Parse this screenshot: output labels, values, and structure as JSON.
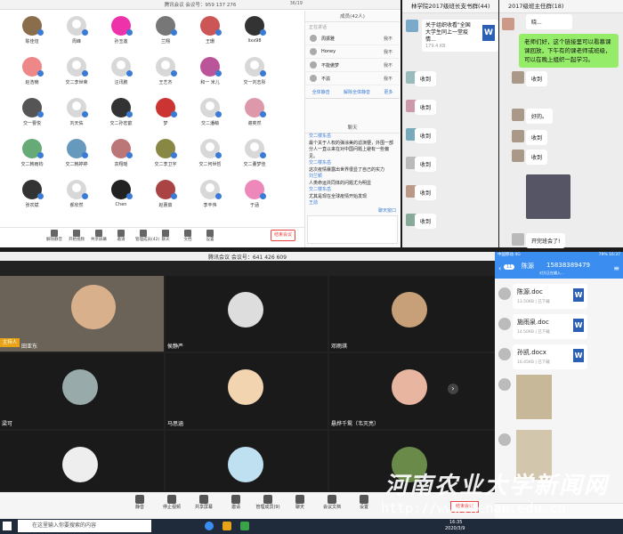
{
  "top_left_meeting": {
    "title": "腾讯会议 会议号：959 137 276",
    "member_count_text": "36/19",
    "participants": [
      {
        "name": "陈佳煊"
      },
      {
        "name": "周峰"
      },
      {
        "name": "孙玉莲"
      },
      {
        "name": "兰翔"
      },
      {
        "name": "王珊"
      },
      {
        "name": "lixx98"
      },
      {
        "name": "赵浩楠"
      },
      {
        "name": "交二李世荣"
      },
      {
        "name": "汪讯鹏"
      },
      {
        "name": "王艺杰"
      },
      {
        "name": "和一 米儿"
      },
      {
        "name": "交一刘志彤"
      },
      {
        "name": "交一曹悦"
      },
      {
        "name": "刘天佑"
      },
      {
        "name": "交二孙宏歆"
      },
      {
        "name": "梦"
      },
      {
        "name": "交二潘萌"
      },
      {
        "name": "谢奕然"
      },
      {
        "name": "交二韩雨钧"
      },
      {
        "name": "交二韩婷婷"
      },
      {
        "name": "袁翔瑶"
      },
      {
        "name": "交二李卫宇"
      },
      {
        "name": "交二何世哲"
      },
      {
        "name": "交二董梦佳"
      },
      {
        "name": "张农斌"
      },
      {
        "name": "郝欣然"
      },
      {
        "name": "Chen"
      },
      {
        "name": "赵蕙茹"
      },
      {
        "name": "李丰伟"
      },
      {
        "name": "于涵"
      }
    ],
    "side_header": "成员(42人)",
    "side_sub": "正在讲话",
    "members": [
      {
        "name": "周振雅",
        "status": "我不"
      },
      {
        "name": "Honey",
        "status": "我不"
      },
      {
        "name": "不能傲梦",
        "status": "我不"
      },
      {
        "name": "不渝",
        "status": "我不"
      }
    ],
    "side_buttons": [
      "全体静音",
      "解除全体静音",
      "更多"
    ],
    "chat_header": "聊天",
    "chat": [
      {
        "who": "交二楼东岳",
        "msg": "最个关于人权的弹涂美的滤演梗，外围一部分人一直以来在对中国问题上避有一些偏见。"
      },
      {
        "who": "交二楼东岳",
        "msg": "这次疫情暴露出世界很显了自己的实力"
      },
      {
        "who": "刘兰颖",
        "msg": "人类命运共同体的问题尤为明显"
      },
      {
        "who": "交二楼东岳",
        "msg": "尤其是现在全球疫情开始发现"
      },
      {
        "who": "王勋",
        "msg": ""
      }
    ],
    "chat_footer": "聊天窗口",
    "toolbar": [
      "解除静音",
      "开始视频",
      "共享屏幕",
      "邀请",
      "管理成员(42)",
      "聊天",
      "文档",
      "设置"
    ],
    "end_button": "结束会议"
  },
  "wechat_a": {
    "title": "林学院2017级班长支书群(44)",
    "file_title": "关于组织收看\"全国大学生同上一堂疫情...",
    "file_size": "179.4 KB",
    "replies": [
      "收到",
      "收到",
      "收到",
      "收到",
      "收到",
      "收到"
    ]
  },
  "wechat_b": {
    "title": "2017级班主任群(18)",
    "top_text": "晓...",
    "notice": "老师们好，这个链接里可以看慕课课回放，下午有的课老师或班级，可以在晚上组织一起学习。",
    "replies": [
      "收到",
      "好的。",
      "收到",
      "收到"
    ],
    "last": "开完班会了!"
  },
  "bottom_meeting": {
    "title": "腾讯会议 会议号：641 426 609",
    "host_tag": "主持人",
    "tiles": [
      "田亚东",
      "侯静严",
      "邓雨琪",
      "梁可",
      "马思涵",
      "悬烨千鸳（韦灭亮）"
    ],
    "toolbar": [
      "静音",
      "停止视频",
      "共享屏幕",
      "邀请",
      "管理成员(9)",
      "聊天",
      "会议文档",
      "设置"
    ],
    "end_button": "结束会议"
  },
  "qq": {
    "status_left": "中国移动 4G",
    "status_right": "79% 16:37",
    "back_count": "11",
    "contact": "陈源",
    "phone": "15838389479",
    "sub": "对方正在输入...",
    "files": [
      {
        "name": "陈源.doc",
        "size": "13.50KB | 已下载"
      },
      {
        "name": "施雨泉.doc",
        "size": "14.50KB | 已下载"
      },
      {
        "name": "孙凯.docx",
        "size": "16.45KB | 已下载"
      }
    ]
  },
  "taskbar": {
    "search_placeholder": "在这里输入你要搜索的内容",
    "time": "16:35",
    "date": "2020/3/9"
  },
  "watermark": {
    "cn": "河南农业大学新闻网",
    "url": "http://www.henau.edu.cn"
  }
}
